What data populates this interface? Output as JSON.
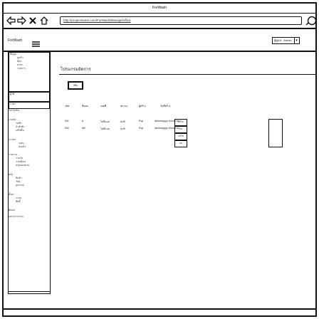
{
  "window": {
    "title": "ForWash",
    "url": "http://projectname.com/ForWash/Manage/office"
  },
  "app": {
    "brand": "ForWash",
    "user_select": "ผู้ดูแล : Admin",
    "user_select_arrow": "▾"
  },
  "sidebar": {
    "items": [
      {
        "label": "ข้อมูล",
        "sub": [
          "ลูกค้า",
          "ห้อง",
          "สาขา",
          "รายการ"
        ]
      },
      {
        "label": "ผู้ใช้",
        "sub": []
      },
      {
        "label": "ราคา",
        "sub": []
      },
      {
        "label": "โปรโมชั่น",
        "sub": []
      },
      {
        "label": "งานซัก",
        "sub": [
          "รอซัก",
          "กำลังซัก",
          "เสร็จสิ้น"
        ]
      },
      {
        "label": "การส่ง",
        "sub": [
          "รอส่ง",
          "ส่งแล้ว"
        ]
      },
      {
        "label": "รายงาน",
        "sub": [
          "รายวัน",
          "รายเดือน",
          "สรุปยอดขาย"
        ]
      },
      {
        "label": "คลัง",
        "sub": [
          "สินค้า",
          "วัสดุ",
          "อุปกรณ์"
        ]
      },
      {
        "label": "ตั้งค่า",
        "sub": [
          "ระบบ",
          "สิทธิ์"
        ]
      },
      {
        "label": "ติดต่อ",
        "sub": []
      },
      {
        "label": "ออกจากระบบ",
        "sub": []
      }
    ]
  },
  "main": {
    "title": "โปรแกรมจัดการ",
    "add_button": "เพิ่ม",
    "table": {
      "headers": [
        "รหัส",
        "ชื่อย่อ",
        "เขตที่",
        "สถานะ",
        "ผู้สร้าง",
        "วันที่สร้าง"
      ],
      "rows": [
        [
          "001",
          "A",
          "ไม่มีแบบ",
          "ปกติ",
          "Pop",
          "dd/mm/yyyy hh:mm:ss"
        ],
        [
          "002",
          "AB",
          "ไม่มีแบบ",
          "ปกติ",
          "Pop",
          "dd/mm/yyyy hh:mm:ss"
        ]
      ],
      "row_actions": [
        "แก้ไข",
        "ลบ"
      ]
    }
  }
}
